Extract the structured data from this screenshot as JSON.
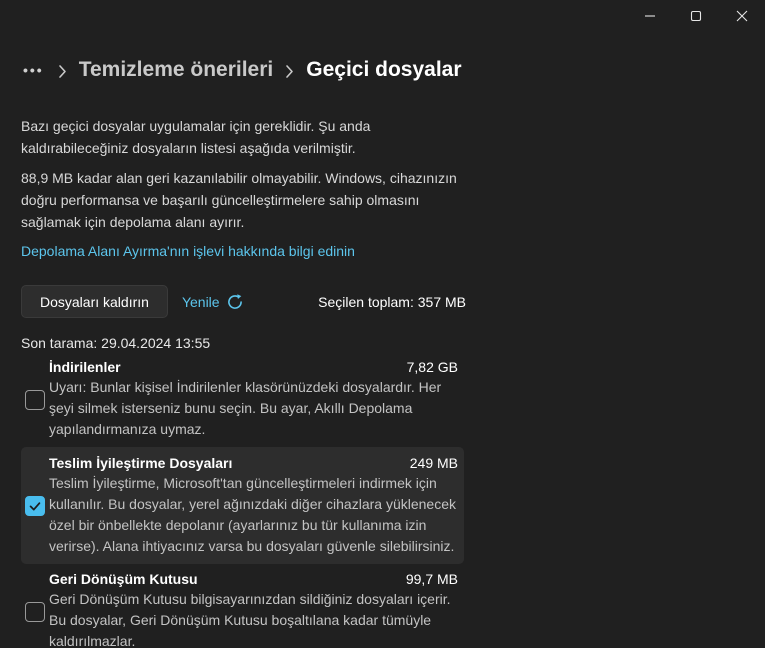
{
  "colors": {
    "background": "#202020",
    "accent": "#5cc5ec",
    "accent-checkbox": "#49bdee"
  },
  "window": {
    "controls": {
      "minimize": "minimize",
      "maximize": "maximize",
      "close": "close"
    }
  },
  "breadcrumb": {
    "ellipsis": "•••",
    "parent": "Temizleme önerileri",
    "current": "Geçici dosyalar"
  },
  "intro": {
    "p1": "Bazı geçici dosyalar uygulamalar için gereklidir. Şu anda kaldırabileceğiniz dosyaların listesi aşağıda verilmiştir.",
    "p2": "88,9 MB kadar alan geri kazanılabilir olmayabilir. Windows, cihazınızın doğru performansa ve başarılı güncelleştirmelere sahip olmasını sağlamak için depolama alanı ayırır."
  },
  "learn_link": "Depolama Alanı Ayırma'nın işlevi hakkında bilgi edinin",
  "toolbar": {
    "remove_label": "Dosyaları kaldırın",
    "refresh_label": "Yenile",
    "selected_total": "Seçilen toplam: 357 MB"
  },
  "last_scan": "Son tarama: 29.04.2024 13:55",
  "items": [
    {
      "title": "İndirilenler",
      "size": "7,82 GB",
      "description": "Uyarı: Bunlar kişisel İndirilenler klasörünüzdeki dosyalardır. Her şeyi silmek isterseniz bunu seçin. Bu ayar, Akıllı Depolama yapılandırmanıza uymaz.",
      "checked": false,
      "highlighted": false
    },
    {
      "title": "Teslim İyileştirme Dosyaları",
      "size": "249 MB",
      "description": "Teslim İyileştirme, Microsoft'tan güncelleştirmeleri indirmek için kullanılır. Bu dosyalar, yerel ağınızdaki diğer cihazlara yüklenecek özel bir önbellekte depolanır (ayarlarınız bu tür kullanıma izin verirse). Alana ihtiyacınız varsa bu dosyaları güvenle silebilirsiniz.",
      "checked": true,
      "highlighted": true
    },
    {
      "title": "Geri Dönüşüm Kutusu",
      "size": "99,7 MB",
      "description": "Geri Dönüşüm Kutusu bilgisayarınızdan sildiğiniz dosyaları içerir. Bu dosyalar, Geri Dönüşüm Kutusu boşaltılana kadar tümüyle kaldırılmazlar.",
      "checked": false,
      "highlighted": false
    }
  ]
}
